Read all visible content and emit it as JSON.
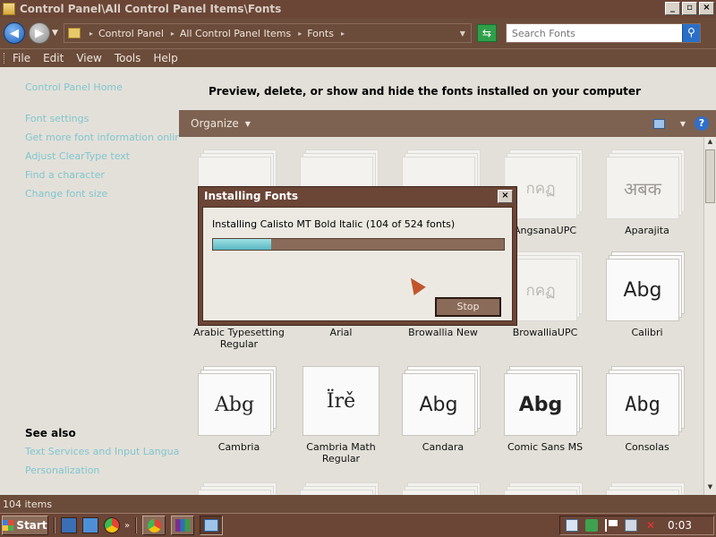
{
  "window": {
    "title": "Control Panel\\All Control Panel Items\\Fonts",
    "buttons": [
      "_",
      "▫",
      "×"
    ]
  },
  "address": {
    "segments": [
      "Control Panel",
      "All Control Panel Items",
      "Fonts"
    ],
    "search_placeholder": "Search Fonts"
  },
  "menu": [
    "File",
    "Edit",
    "View",
    "Tools",
    "Help"
  ],
  "left_pane": {
    "home": "Control Panel Home",
    "links": [
      "Font settings",
      "Get more font information online",
      "Adjust ClearType text",
      "Find a character",
      "Change font size"
    ],
    "see_also_title": "See also",
    "see_also": [
      "Text Services and Input Language",
      "Personalization"
    ]
  },
  "heading": "Preview, delete, or show and hide the fonts installed on your computer",
  "command_bar": {
    "organize": "Organize",
    "help": "?"
  },
  "fonts": [
    {
      "name": "",
      "sample": ""
    },
    {
      "name": "",
      "sample": ""
    },
    {
      "name": "",
      "sample": ""
    },
    {
      "name": "AngsanaUPC",
      "sample": "กคฏ"
    },
    {
      "name": "Aparajita",
      "sample": "अबक"
    },
    {
      "name": "Arabic Typesetting Regular",
      "sample": ""
    },
    {
      "name": "Arial",
      "sample": ""
    },
    {
      "name": "Browallia New",
      "sample": ""
    },
    {
      "name": "BrowalliaUPC",
      "sample": "กคฏ"
    },
    {
      "name": "Calibri",
      "sample": "Abg"
    },
    {
      "name": "Cambria",
      "sample": "Abg"
    },
    {
      "name": "Cambria Math Regular",
      "sample": "Ïrě"
    },
    {
      "name": "Candara",
      "sample": "Abg"
    },
    {
      "name": "Comic Sans MS",
      "sample": "Abg"
    },
    {
      "name": "Consolas",
      "sample": "Abg"
    }
  ],
  "dialog": {
    "title": "Installing Fonts",
    "close": "×",
    "message": "Installing Calisto MT Bold Italic (104 of 524 fonts)",
    "progress_current": 104,
    "progress_total": 524,
    "stop_label": "Stop"
  },
  "status": {
    "count": "104 items"
  },
  "taskbar": {
    "start_label": "Start",
    "chevron": "»",
    "clock": "0:03"
  },
  "colors": {
    "link": "#7fc6cf",
    "chrome": "#6b4b3a",
    "progress": "#58b7c2"
  }
}
